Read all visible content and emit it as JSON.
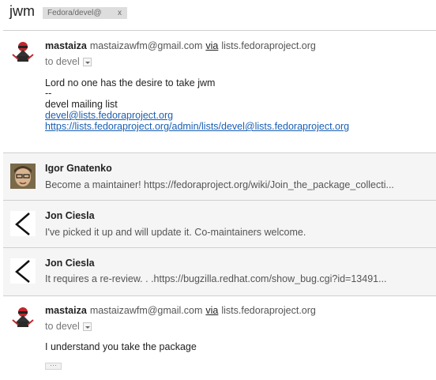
{
  "thread": {
    "subject": "jwm",
    "label": "Fedora/devel@",
    "label_remove": "x"
  },
  "messages": [
    {
      "sender": "mastaiza",
      "email": "mastaizawfm@gmail.com",
      "via": "via",
      "list_domain": "lists.fedoraproject.org",
      "to": "to devel",
      "body": [
        "Lord no one has the desire to take jwm",
        "--",
        "devel mailing list"
      ],
      "links": [
        "devel@lists.fedoraproject.org",
        "https://lists.fedoraproject.org/admin/lists/devel@lists.fedoraproject.org"
      ]
    },
    {
      "sender": "Igor Gnatenko",
      "snippet": "Become a maintainer! https://fedoraproject.org/wiki/Join_the_package_collecti..."
    },
    {
      "sender": "Jon Ciesla",
      "snippet": "I've picked it up and will update it. Co-maintainers welcome."
    },
    {
      "sender": "Jon Ciesla",
      "snippet": "It requires a re-review. . .https://bugzilla.redhat.com/show_bug.cgi?id=13491..."
    },
    {
      "sender": "mastaiza",
      "email": "mastaizawfm@gmail.com",
      "via": "via",
      "list_domain": "lists.fedoraproject.org",
      "to": "to devel",
      "body": [
        "I understand you take the package"
      ],
      "trimmed_label": "···"
    }
  ],
  "icons": {
    "sender_avatar_1": "ninja-avatar-icon",
    "sender_avatar_2": "person-photo-avatar-icon",
    "sender_avatar_3": "arrow-logo-avatar-icon",
    "dropdown": "chevron-down-icon"
  }
}
